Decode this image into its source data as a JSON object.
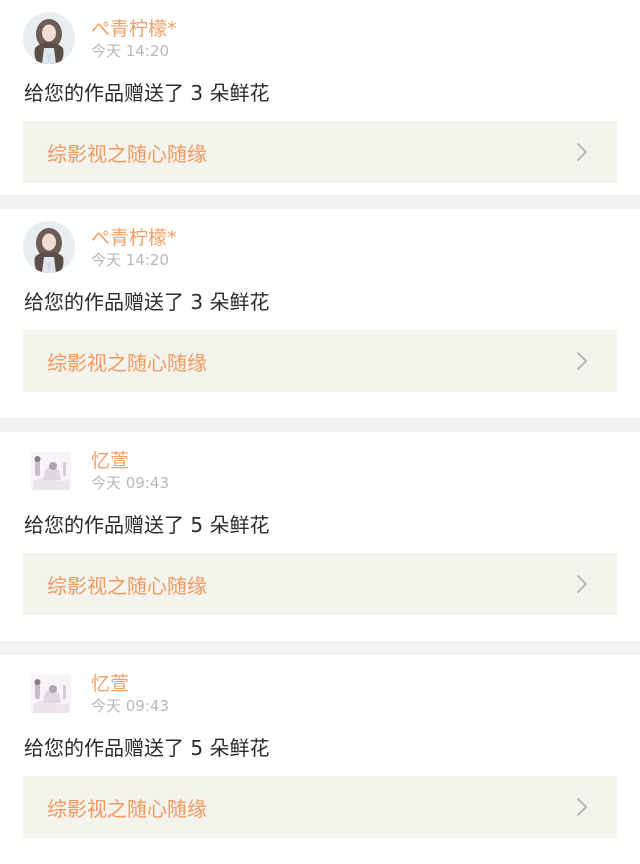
{
  "feed": {
    "items": [
      {
        "user": "ぺ青柠檬*",
        "time": "今天 14:20",
        "message": "给您的作品赠送了 3 朵鲜花",
        "work": "综影视之随心随缘",
        "avatar_icon": "girl-portrait-avatar-icon"
      },
      {
        "user": "ぺ青柠檬*",
        "time": "今天 14:20",
        "message": "给您的作品赠送了 3 朵鲜花",
        "work": "综影视之随心随缘",
        "avatar_icon": "girl-portrait-avatar-icon"
      },
      {
        "user": "忆萱",
        "time": "今天 09:43",
        "message": "给您的作品赠送了 5 朵鲜花",
        "work": "综影视之随心随缘",
        "avatar_icon": "illustration-avatar-icon"
      },
      {
        "user": "忆萱",
        "time": "今天 09:43",
        "message": "给您的作品赠送了 5 朵鲜花",
        "work": "综影视之随心随缘",
        "avatar_icon": "illustration-avatar-icon"
      }
    ]
  },
  "colors": {
    "username": "#f0a066",
    "work_title": "#ef9a62",
    "timestamp": "#b8b8b8",
    "card_link_bg": "#f4f3ec",
    "page_bg": "#f2f2f2"
  }
}
